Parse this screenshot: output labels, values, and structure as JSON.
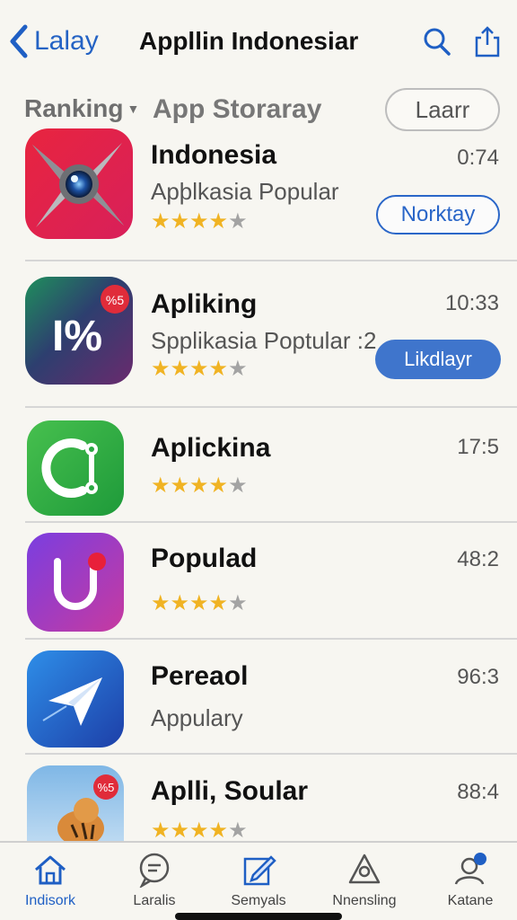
{
  "header": {
    "back_label": "Lalay",
    "title": "Appllin Indonesiar"
  },
  "filters": {
    "ranking_label": "Ranking",
    "store_label": "App Storaray",
    "action_label": "Laarr"
  },
  "apps": [
    {
      "name": "Indonesia",
      "subtitle": "Apþlkasia Popular",
      "time": "0:74",
      "button": "Norktay",
      "rating": 4
    },
    {
      "name": "Apliking",
      "subtitle": "Spplikasia Poptular :2",
      "time": "10:33",
      "button": "Likdlayr",
      "rating": 4,
      "icon_badge": "%5",
      "icon_text": "I%"
    },
    {
      "name": "Aplickina",
      "time": "17:5",
      "rating": 4
    },
    {
      "name": "Populad",
      "time": "48:2",
      "rating": 4
    },
    {
      "name": "Pereaol",
      "subtitle": "Appulary",
      "time": "96:3"
    },
    {
      "name": "Aplli, Soular",
      "time": "88:4",
      "rating": 4,
      "icon_badge": "%5"
    }
  ],
  "tabs": [
    {
      "label": "Indisork",
      "icon": "home-icon",
      "active": true
    },
    {
      "label": "Laralis",
      "icon": "chat-icon"
    },
    {
      "label": "Semyals",
      "icon": "edit-icon"
    },
    {
      "label": "Nnensling",
      "icon": "bag-icon"
    },
    {
      "label": "Katane",
      "icon": "profile-icon"
    }
  ],
  "colors": {
    "accent": "#1f5fc4",
    "star": "#f0b323",
    "background": "#f7f6f1"
  }
}
